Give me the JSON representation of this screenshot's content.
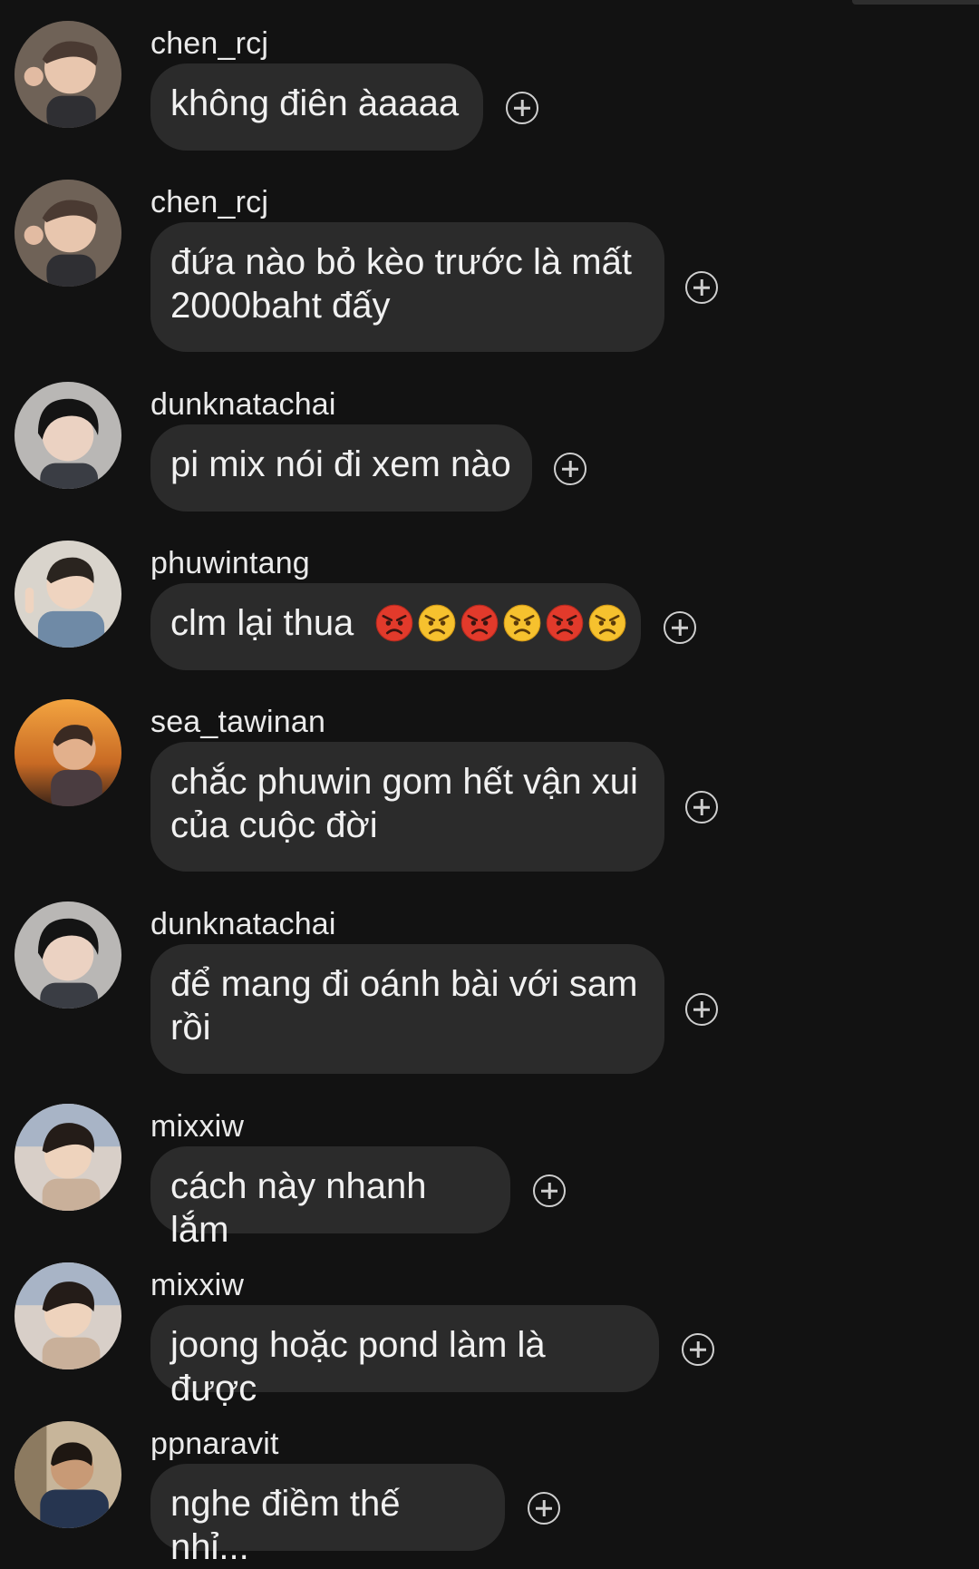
{
  "messages": [
    {
      "username": "chen_rcj",
      "text": "không điên àaaaa",
      "avatar": "avatar-chen-rcj"
    },
    {
      "username": "chen_rcj",
      "text": "đứa nào bỏ kèo trước là mất 2000baht đấy",
      "avatar": "avatar-chen-rcj"
    },
    {
      "username": "dunknatachai",
      "text": "pi mix nói đi xem nào",
      "avatar": "avatar-dunknatachai"
    },
    {
      "username": "phuwintang",
      "text": "clm lại thua",
      "avatar": "avatar-phuwintang",
      "emojis": [
        "angry-red-face",
        "angry-face",
        "angry-red-face",
        "angry-face",
        "angry-red-face",
        "angry-face"
      ]
    },
    {
      "username": "sea_tawinan",
      "text": "chắc phuwin gom hết vận xui của cuộc đời",
      "avatar": "avatar-sea-tawinan"
    },
    {
      "username": "dunknatachai",
      "text": "để mang đi oánh bài với sam rồi",
      "avatar": "avatar-dunknatachai"
    },
    {
      "username": "mixxiw",
      "text": "cách này nhanh lắm",
      "avatar": "avatar-mixxiw"
    },
    {
      "username": "mixxiw",
      "text": "joong hoặc pond làm là được",
      "avatar": "avatar-mixxiw"
    },
    {
      "username": "ppnaravit",
      "text": "nghe điềm thế nhỉ...",
      "avatar": "avatar-ppnaravit"
    }
  ],
  "icons": {
    "react": "add-reaction-icon"
  },
  "colors": {
    "background": "#121212",
    "bubble": "#2b2b2b",
    "text": "#f1f1f1"
  }
}
